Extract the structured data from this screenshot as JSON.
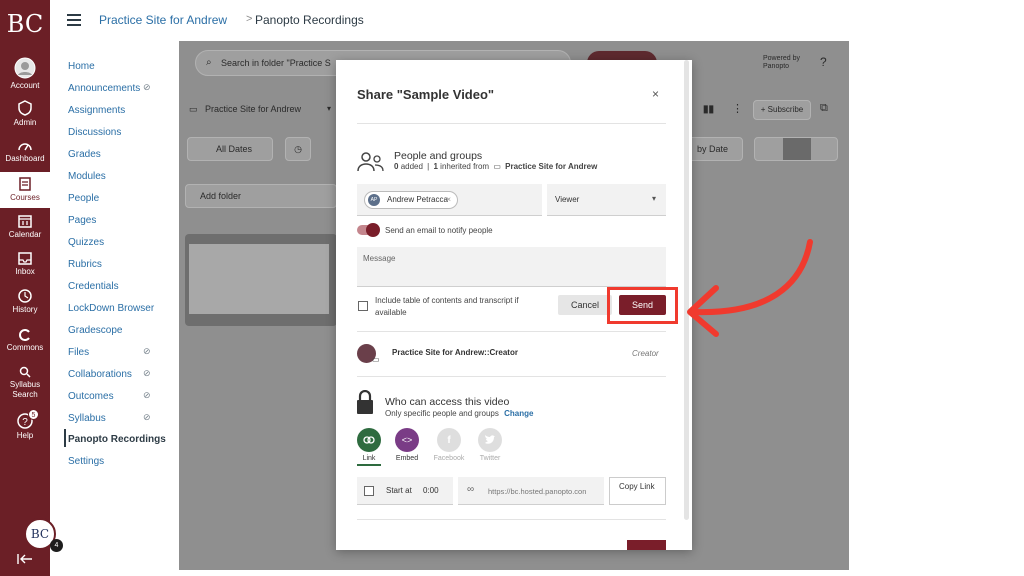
{
  "global_nav": {
    "logo": "BC",
    "items": [
      {
        "label": "Account",
        "icon": "account-icon"
      },
      {
        "label": "Admin",
        "icon": "admin-icon"
      },
      {
        "label": "Dashboard",
        "icon": "dashboard-icon"
      },
      {
        "label": "Courses",
        "icon": "courses-icon"
      },
      {
        "label": "Calendar",
        "icon": "calendar-icon"
      },
      {
        "label": "Inbox",
        "icon": "inbox-icon"
      },
      {
        "label": "History",
        "icon": "history-icon"
      },
      {
        "label": "Commons",
        "icon": "commons-icon"
      },
      {
        "label": "Syllabus Search",
        "icon": "syllabus-search-icon"
      },
      {
        "label": "Help",
        "icon": "help-icon",
        "badge": "5"
      }
    ],
    "user_avatar": "BC",
    "user_badge": "4",
    "accent_color": "#6b1f26"
  },
  "breadcrumb": {
    "course": "Practice Site for Andrew",
    "separator": ">",
    "page": "Panopto Recordings"
  },
  "course_nav": {
    "items": [
      "Home",
      "Announcements",
      "Assignments",
      "Discussions",
      "Grades",
      "Modules",
      "People",
      "Pages",
      "Quizzes",
      "Rubrics",
      "Credentials",
      "LockDown Browser",
      "Gradescope",
      "Files",
      "Collaborations",
      "Outcomes",
      "Syllabus",
      "Panopto Recordings",
      "Settings"
    ],
    "active": "Panopto Recordings"
  },
  "panopto": {
    "search_placeholder": "Search in folder \"Practice S",
    "powered_by": "Powered by Panopto",
    "help": "?",
    "folder": "Practice Site for Andrew",
    "subscribe": "+ Subscribe",
    "all_dates": "All Dates",
    "sort": "by Date",
    "add_folder": "Add folder"
  },
  "modal": {
    "title": "Share \"Sample Video\"",
    "close": "×",
    "people_heading": "People and groups",
    "added_count": "0",
    "added_label": "added",
    "inherited_count": "1",
    "inherited_label": "inherited from",
    "inherited_from": "Practice Site for Andrew",
    "chip_initials": "AP",
    "chip_name": "Andrew Petracca",
    "role": "Viewer",
    "notify_label": "Send an email to notify people",
    "message_placeholder": "Message",
    "include_label": "Include table of contents and transcript if available",
    "cancel": "Cancel",
    "send": "Send",
    "creator_name": "Practice Site for Andrew::Creator",
    "creator_role": "Creator",
    "access_heading": "Who can access this video",
    "access_sub": "Only specific people and groups",
    "change": "Change",
    "tabs": [
      {
        "label": "Link",
        "icon": "link-icon",
        "color": "#2e6b3f"
      },
      {
        "label": "Embed",
        "icon": "embed-icon",
        "color": "#7a3c86"
      },
      {
        "label": "Facebook",
        "icon": "facebook-icon",
        "color": "#d8d8d8"
      },
      {
        "label": "Twitter",
        "icon": "twitter-icon",
        "color": "#d8d8d8"
      }
    ],
    "start_at_label": "Start at",
    "start_at_value": "0:00",
    "url": "https://bc.hosted.panopto.con",
    "copy_link": "Copy Link",
    "send_color": "#7a1e2a"
  },
  "annotation": {
    "highlight_color": "#f03a2e"
  }
}
